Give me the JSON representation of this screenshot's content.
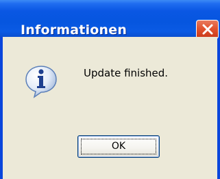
{
  "window": {
    "title": "Informationen",
    "close_icon": "close-icon"
  },
  "dialog": {
    "icon": "info-icon",
    "message": "Update finished.",
    "ok_label": "OK"
  },
  "colors": {
    "titlebar": "#0a57e3",
    "close_button": "#e2542f",
    "dialog_face": "#ece9d8",
    "button_border": "#003c74"
  }
}
